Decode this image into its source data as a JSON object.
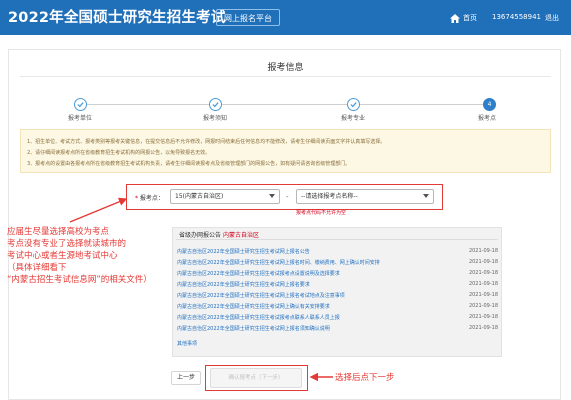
{
  "header": {
    "title": "2022年全国硕士研究生招生考试",
    "platform_badge": "网上报名平台",
    "home_label": "首页",
    "user_phone": "13674558941",
    "exit_label": "退出"
  },
  "main": {
    "card_title": "报考信息",
    "steps": [
      {
        "label": "报考单位",
        "state": "done",
        "icon": "check-icon"
      },
      {
        "label": "报考须知",
        "state": "done",
        "icon": "check-icon"
      },
      {
        "label": "报考专业",
        "state": "done",
        "icon": "check-icon"
      },
      {
        "label": "报考点",
        "state": "active",
        "number": "4"
      }
    ],
    "notice_lines": [
      "1、招生单位、考试方式、报考类别等报考关键信息，在提交信息后不允许修改，网报时间结束后任何信息均不能修改，请考生仔细阅读页面文字并认真填写选择。",
      "2、请仔细阅读报考点所在省级教育招生考试机构的网报公告，以免导致报名无效。",
      "3、报考点的设置由各报考点所在省级教育招生考试机构负责，请考生仔细阅读报考点及省级管理部门的网报公告，如有疑问请咨询省级管理部门。"
    ],
    "apply_point": {
      "label": "报考点：",
      "required_mark": "*",
      "province_value": "15(内蒙古自治区)",
      "point_value": "--请选择报考点名称--",
      "separator": "-",
      "error_text": "报考点代码不允许为空"
    },
    "announcements": {
      "heading_prefix": "省级办网报公告",
      "heading_place": "内蒙古自治区",
      "items": [
        {
          "title": "内蒙古自治区2022年全国硕士研究生招生考试网上报名公告",
          "date": "2021-09-18"
        },
        {
          "title": "内蒙古自治区2022年全国硕士研究生招生考试网上报名时间、缴纳费用、网上确认时间安排",
          "date": "2021-09-18"
        },
        {
          "title": "内蒙古自治区2022年全国硕士研究生招生考试报考点设置说明及选择要求",
          "date": "2021-09-18"
        },
        {
          "title": "内蒙古自治区2022年全国硕士研究生招生考试网上报名要求",
          "date": "2021-09-18"
        },
        {
          "title": "内蒙古自治区2022年全国硕士研究生招生考试网上报名考试地点及注意事项",
          "date": "2021-09-18"
        },
        {
          "title": "内蒙古自治区2022年全国硕士研究生招生考试网上确认有关安排要求",
          "date": "2021-09-18"
        },
        {
          "title": "内蒙古自治区2022年全国硕士研究生招生考试报考点联系人联系人员上报",
          "date": "2021-09-18"
        },
        {
          "title": "内蒙古自治区2022年全国硕士研究生招生考试网上报名须知确认说明",
          "date": "2021-09-18"
        }
      ],
      "more_label": "其他事项"
    },
    "buttons": {
      "prev_label": "上一步",
      "next_label": "确认报考点（下一步）"
    }
  },
  "annotations": {
    "left_lines": [
      "应届生尽量选择高校为考点",
      "考点没有专业了选择就读城市的",
      "考试中心或者生源地考试中心",
      "（具体详细看下",
      "“内蒙古招生考试信息网”的相关文件）"
    ],
    "right_text": "选择后点下一步"
  },
  "colors": {
    "header_bg": "#1f6fb9",
    "accent": "#2f7fc9",
    "annotation_red": "#e53935",
    "link_blue": "#1e6fc2",
    "notice_bg": "#fcf8e3"
  }
}
